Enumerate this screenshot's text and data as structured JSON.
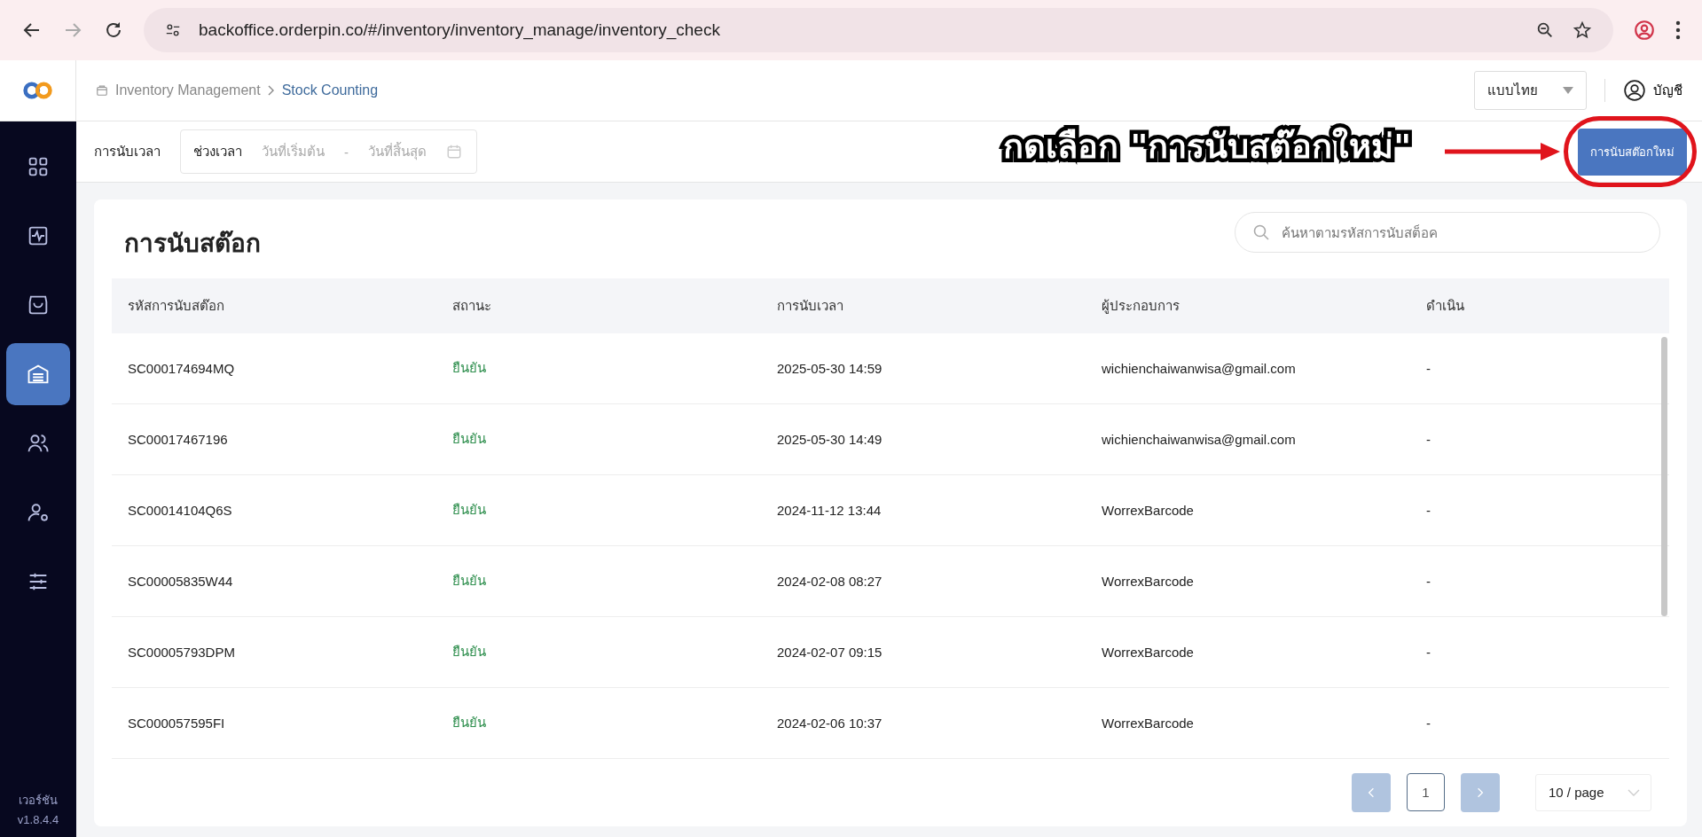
{
  "browser": {
    "url": "backoffice.orderpin.co/#/inventory/inventory_manage/inventory_check"
  },
  "breadcrumb": [
    "Inventory Management",
    "Stock Counting"
  ],
  "header": {
    "language": "แบบไทย",
    "account": "บัญชี"
  },
  "sidebar": {
    "items": [
      {
        "kind": "grid",
        "selected": false
      },
      {
        "kind": "activity",
        "selected": false
      },
      {
        "kind": "bag",
        "selected": false
      },
      {
        "kind": "warehouse",
        "selected": true
      },
      {
        "kind": "users",
        "selected": false
      },
      {
        "kind": "user-settings",
        "selected": false
      },
      {
        "kind": "sliders",
        "selected": false
      }
    ],
    "version_label": "เวอร์ชัน",
    "version": "v1.8.4.4"
  },
  "filter": {
    "label": "การนับเวลา",
    "range_label": "ช่วงเวลา",
    "start_placeholder": "วันที่เริ่มต้น",
    "separator": "-",
    "end_placeholder": "วันที่สิ้นสุด"
  },
  "annotation": {
    "text": "กดเลือก \"การนับสต๊อกใหม่\""
  },
  "new_button": "การนับสต๊อกใหม่",
  "title": "การนับสต๊อก",
  "search": {
    "placeholder": "ค้นหาตามรหัสการนับสต็อค"
  },
  "table": {
    "columns": [
      "รหัสการนับสต๊อก",
      "สถานะ",
      "การนับเวลา",
      "ผู้ประกอบการ",
      "ดำเนิน"
    ],
    "rows": [
      [
        "SC000174694MQ",
        "ยืนยัน",
        "2025-05-30 14:59",
        "wichienchaiwanwisa@gmail.com",
        "-"
      ],
      [
        "SC00017467196",
        "ยืนยัน",
        "2025-05-30 14:49",
        "wichienchaiwanwisa@gmail.com",
        "-"
      ],
      [
        "SC00014104Q6S",
        "ยืนยัน",
        "2024-11-12 13:44",
        "WorrexBarcode",
        "-"
      ],
      [
        "SC00005835W44",
        "ยืนยัน",
        "2024-02-08 08:27",
        "WorrexBarcode",
        "-"
      ],
      [
        "SC00005793DPM",
        "ยืนยัน",
        "2024-02-07 09:15",
        "WorrexBarcode",
        "-"
      ],
      [
        "SC000057595FI",
        "ยืนยัน",
        "2024-02-06 10:37",
        "WorrexBarcode",
        "-"
      ]
    ]
  },
  "pagination": {
    "prev_disabled": true,
    "pages": [
      {
        "label": "1",
        "selected": true
      }
    ],
    "next_disabled": true,
    "page_size": "10 / page"
  }
}
